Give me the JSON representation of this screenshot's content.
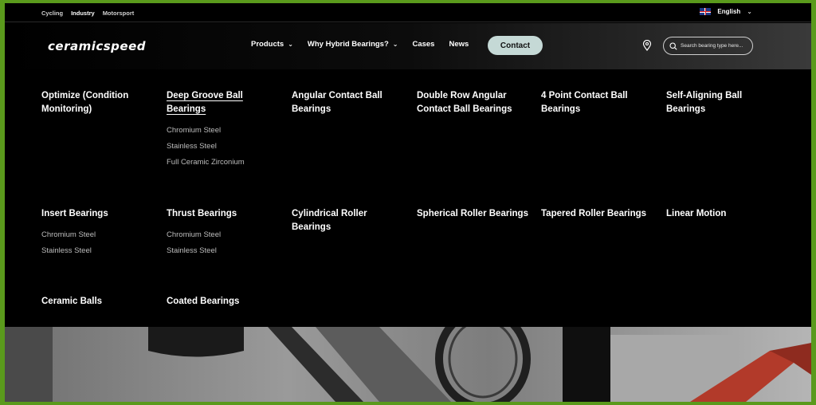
{
  "utility": {
    "links": [
      "Cycling",
      "Industry",
      "Motorsport"
    ],
    "active": "Industry",
    "language": "English"
  },
  "header": {
    "logo": "ceramicspeed",
    "nav": [
      {
        "label": "Products",
        "dropdown": true
      },
      {
        "label": "Why Hybrid Bearings?",
        "dropdown": true
      },
      {
        "label": "Cases",
        "dropdown": false
      },
      {
        "label": "News",
        "dropdown": false
      }
    ],
    "contact": "Contact",
    "search_placeholder": "Search bearing type here..."
  },
  "menu": {
    "rows": [
      [
        {
          "title": "Optimize (Condition Monitoring)",
          "items": []
        },
        {
          "title": "Deep Groove Ball Bearings",
          "items": [
            "Chromium Steel",
            "Stainless Steel",
            "Full Ceramic Zirconium"
          ],
          "active": true
        },
        {
          "title": "Angular Contact Ball Bearings",
          "items": []
        },
        {
          "title": "Double Row Angular Contact Ball Bearings",
          "items": []
        },
        {
          "title": "4 Point Contact Ball Bearings",
          "items": []
        },
        {
          "title": "Self-Aligning Ball Bearings",
          "items": []
        }
      ],
      [
        {
          "title": "Insert Bearings",
          "items": [
            "Chromium Steel",
            "Stainless Steel"
          ]
        },
        {
          "title": "Thrust Bearings",
          "items": [
            "Chromium Steel",
            "Stainless Steel"
          ]
        },
        {
          "title": "Cylindrical Roller Bearings",
          "items": []
        },
        {
          "title": "Spherical Roller Bearings",
          "items": []
        },
        {
          "title": "Tapered Roller Bearings",
          "items": []
        },
        {
          "title": "Linear Motion",
          "items": []
        }
      ],
      [
        {
          "title": "Ceramic Balls",
          "items": []
        },
        {
          "title": "Coated Bearings",
          "items": []
        }
      ]
    ]
  },
  "colors": {
    "accent": "#c5d9d6",
    "frame": "#5a9a1c",
    "background": "#000000"
  }
}
